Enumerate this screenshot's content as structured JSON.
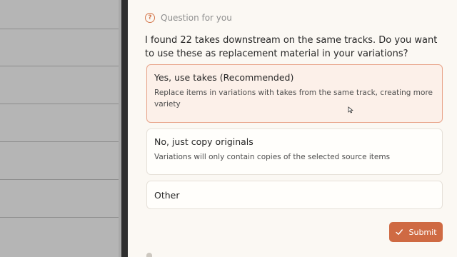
{
  "dialog": {
    "header_label": "Question for you",
    "header_icon": "question-icon",
    "question": "I found 22 takes downstream on the same tracks. Do you want to use these as replacement material in your variations?"
  },
  "options": [
    {
      "title": "Yes, use takes (Recommended)",
      "description": "Replace items in variations with takes from the same track, creating more variety",
      "selected": true
    },
    {
      "title": "No, just copy originals",
      "description": "Variations will only contain copies of the selected source items",
      "selected": false
    },
    {
      "title": "Other",
      "selected": false
    }
  ],
  "submit": {
    "label": "Submit",
    "icon": "check-icon"
  },
  "colors": {
    "accent": "#cf6a43",
    "selected_bg": "#fcf0e9",
    "selected_border": "#e8a48a",
    "panel_bg": "#fbf8f3"
  }
}
